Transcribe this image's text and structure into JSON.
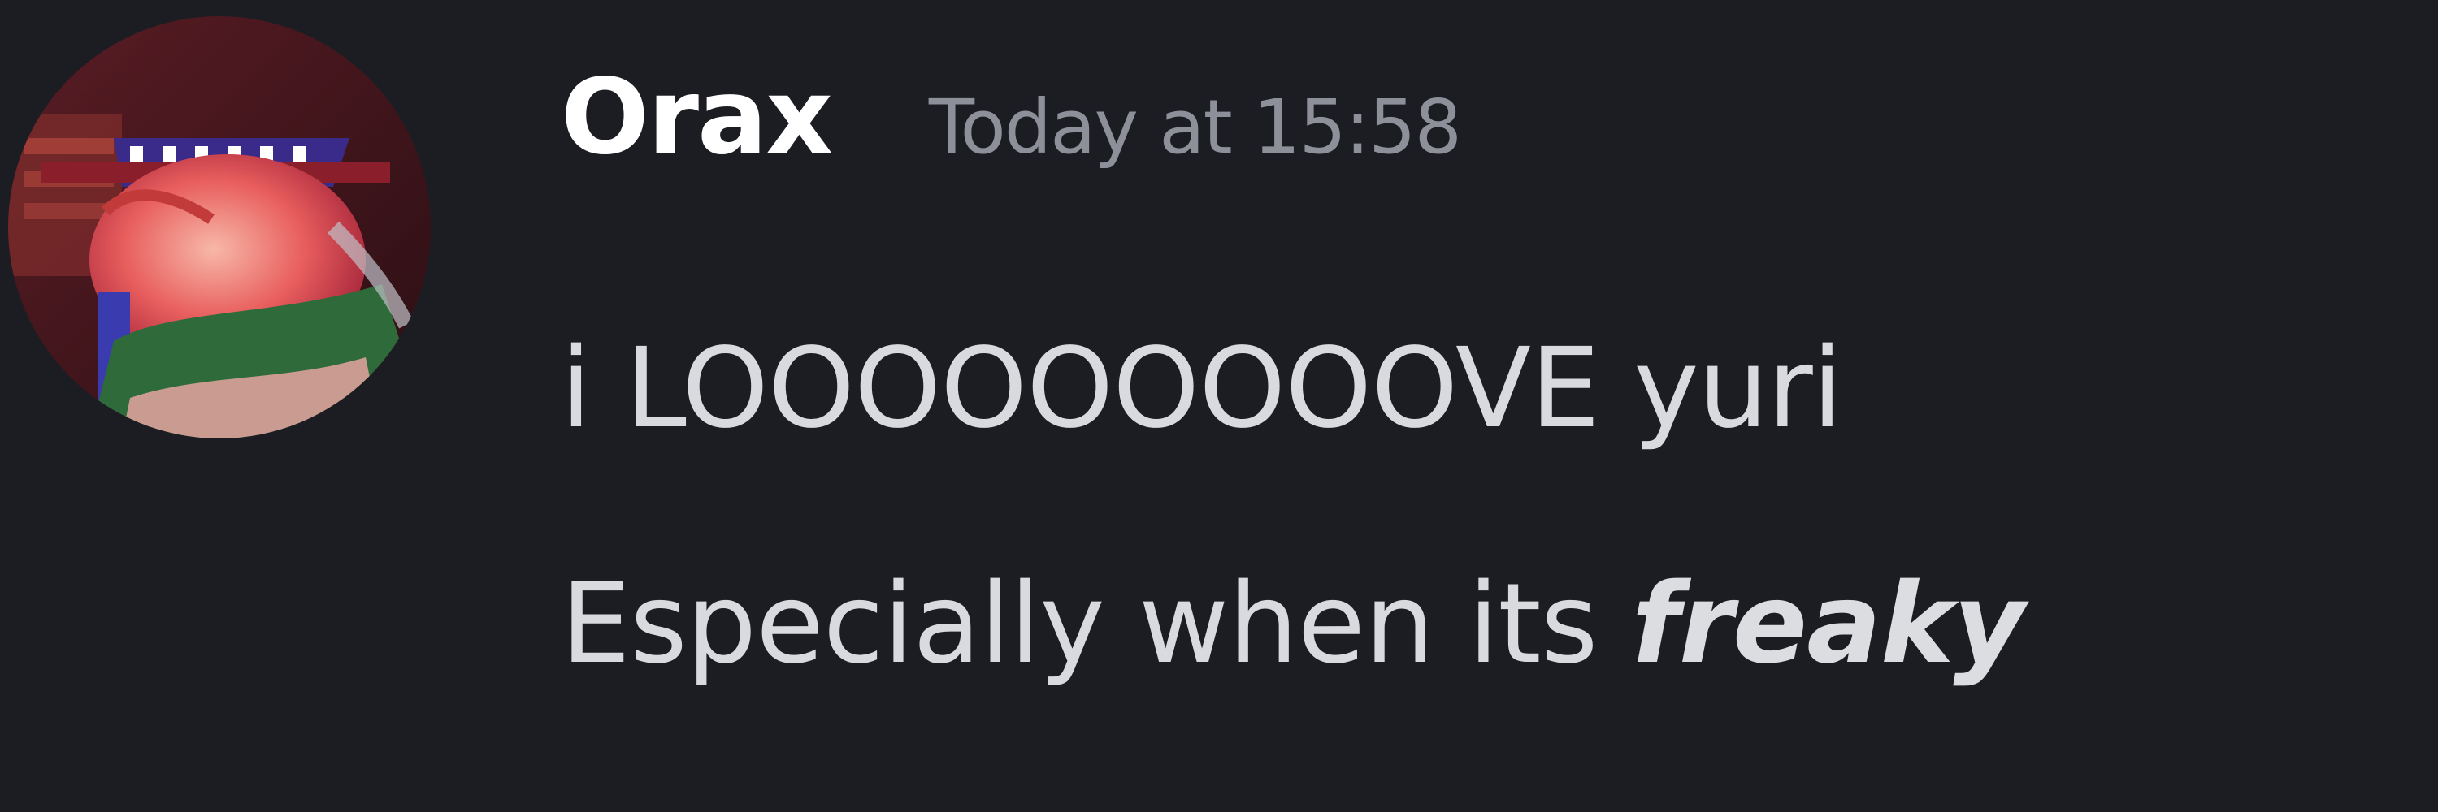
{
  "message": {
    "author": "Orax",
    "timestamp": "Today at 15:58",
    "lines": [
      {
        "text": "i LOOOOOOOOOVE yuri"
      },
      {
        "text": "Especially when its ",
        "emphasis": "freaky"
      }
    ]
  },
  "colors": {
    "background": "#1c1d22",
    "username": "#ffffff",
    "timestamp": "#8e9099",
    "body_text": "#d9dadd"
  },
  "icons": {
    "avatar": "user-avatar-image"
  }
}
